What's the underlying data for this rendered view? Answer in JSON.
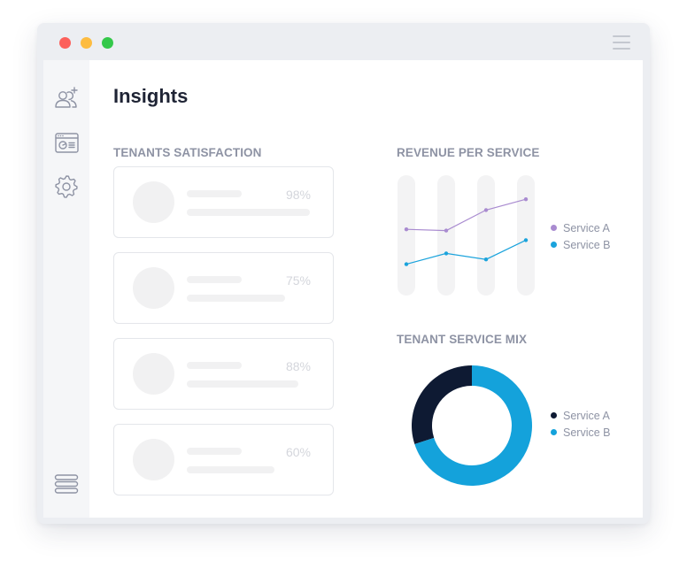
{
  "page": {
    "title": "Insights"
  },
  "colors": {
    "service_a_line": "#a98bd0",
    "service_b_line": "#1aa3dc",
    "donut_dark": "#0e1a33",
    "donut_blue": "#14a2db"
  },
  "sidebar": {
    "items": [
      {
        "icon": "add-user-icon"
      },
      {
        "icon": "dashboard-icon"
      },
      {
        "icon": "gear-icon"
      }
    ],
    "footer_icon": "stack-menu-icon"
  },
  "satisfaction": {
    "title": "TENANTS SATISFACTION",
    "cards": [
      {
        "percent": "98%"
      },
      {
        "percent": "75%"
      },
      {
        "percent": "88%"
      },
      {
        "percent": "60%"
      }
    ]
  },
  "revenue": {
    "title": "REVENUE PER SERVICE",
    "legend": [
      "Service A",
      "Service B"
    ]
  },
  "mix": {
    "title": "TENANT SERVICE MIX",
    "legend": [
      "Service A",
      "Service B"
    ]
  },
  "chart_data": [
    {
      "type": "line",
      "title": "REVENUE PER SERVICE",
      "x": [
        1,
        2,
        3,
        4
      ],
      "ylim": [
        0,
        10
      ],
      "grid": false,
      "legend_position": "right",
      "series": [
        {
          "name": "Service A",
          "values": [
            5.5,
            5.4,
            7.1,
            8.0
          ]
        },
        {
          "name": "Service B",
          "values": [
            2.6,
            3.5,
            3.0,
            4.6
          ]
        }
      ]
    },
    {
      "type": "pie",
      "title": "TENANT SERVICE MIX",
      "donut": true,
      "legend_position": "right",
      "categories": [
        "Service A",
        "Service B"
      ],
      "values": [
        30,
        70
      ]
    }
  ]
}
